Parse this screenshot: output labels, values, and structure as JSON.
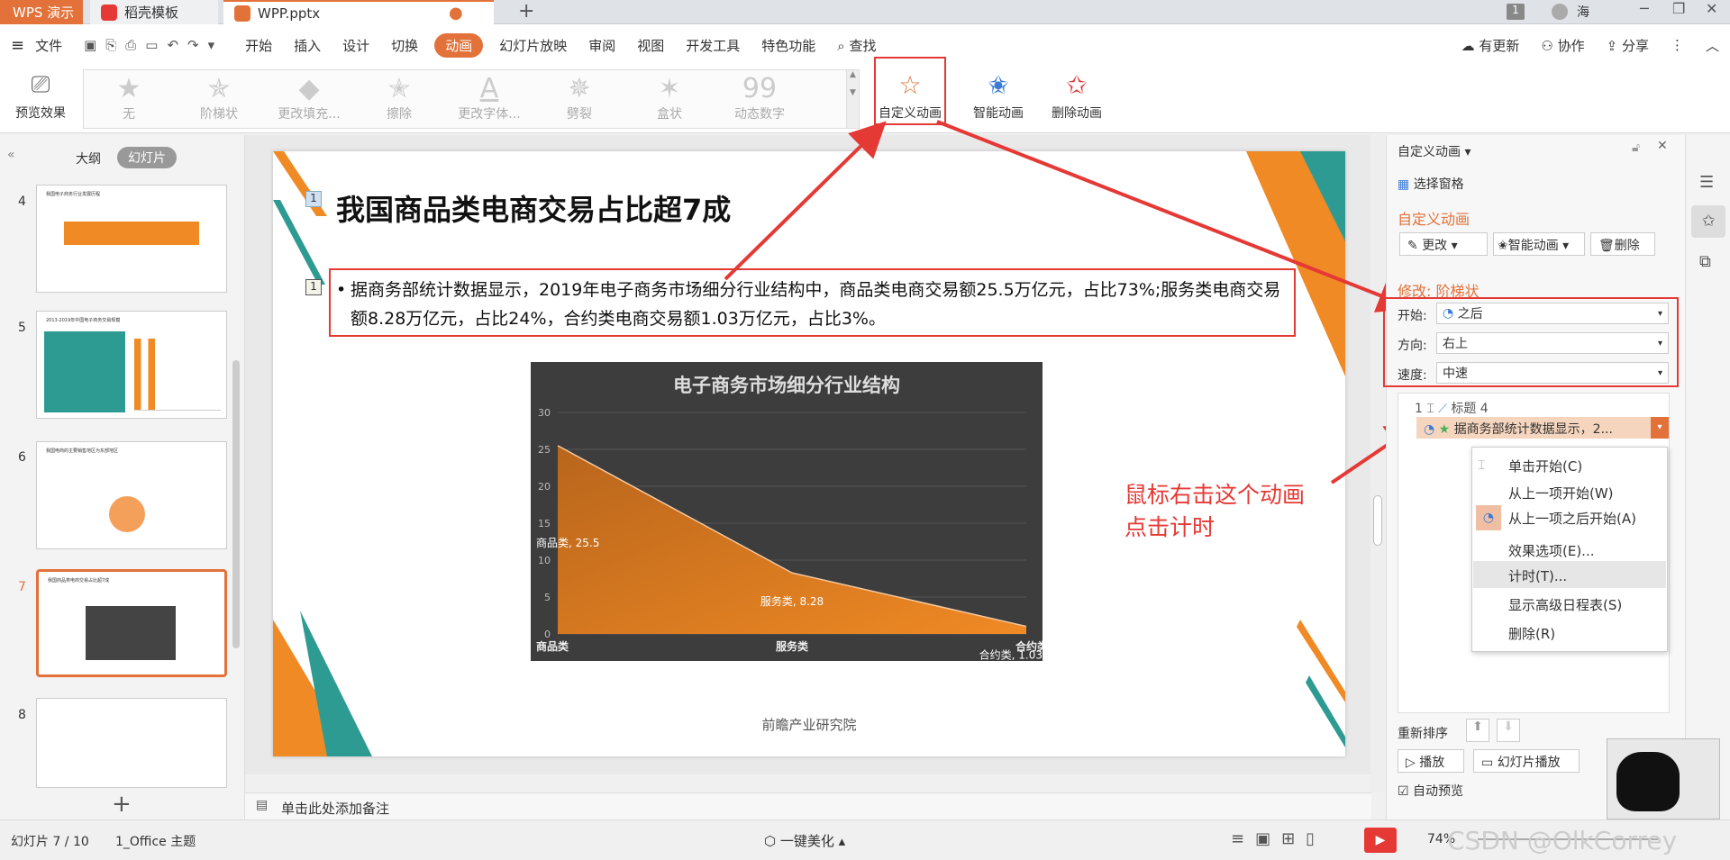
{
  "tabs": {
    "app": "WPS 演示",
    "template": "稻壳模板",
    "file": "WPP.pptx",
    "user": "海",
    "count": "1"
  },
  "menu": {
    "file": "文件",
    "items": [
      "开始",
      "插入",
      "设计",
      "切换",
      "动画",
      "幻灯片放映",
      "审阅",
      "视图",
      "开发工具",
      "特色功能"
    ],
    "active": "动画",
    "search": "查找",
    "right": [
      "有更新",
      "协作",
      "分享"
    ]
  },
  "ribbon": {
    "preview": "预览效果",
    "gallery": [
      "无",
      "阶梯状",
      "更改填充...",
      "擦除",
      "更改字体...",
      "劈裂",
      "盒状",
      "动态数字"
    ],
    "custom": "自定义动画",
    "smart": "智能动画",
    "delete": "删除动画"
  },
  "leftpane": {
    "outline": "大纲",
    "slides": "幻灯片",
    "nums": [
      "4",
      "5",
      "6",
      "7",
      "8"
    ],
    "add": "+",
    "thumb4": "我国电子商务行业发展历程",
    "thumb5": "2013-2019年中国电子商务交易规模",
    "thumb6": "我国电商的主要销售地区为东部地区",
    "thumb7": "我国商品类电商交易占比超7成"
  },
  "slide": {
    "title": "我国商品类电商交易占比超7成",
    "bullet": "据商务部统计数据显示，2019年电子商务市场细分行业结构中，商品类电商交易额25.5万亿元，占比73%;服务类电商交易额8.28万亿元，占比24%，合约类电商交易额1.03万亿元，占比3%。",
    "source": "前瞻产业研究院",
    "marker1": "1",
    "marker2": "1"
  },
  "chart_data": {
    "type": "area",
    "title": "电子商务市场细分行业结构",
    "categories": [
      "商品类",
      "服务类",
      "合约类"
    ],
    "values": [
      25.5,
      8.28,
      1.03
    ],
    "ylim": [
      0,
      30
    ],
    "yticks": [
      0,
      5,
      10,
      15,
      20,
      25,
      30
    ],
    "data_labels": [
      "商品类, 25.5",
      "服务类, 8.28",
      "合约类, 1.03"
    ],
    "color": "#e2771e"
  },
  "annotation": {
    "text1": "鼠标右击这个动画",
    "text2": "点击计时"
  },
  "rightpane": {
    "header": "自定义动画",
    "select": "选择窗格",
    "section": "自定义动画",
    "change": "更改",
    "smart": "智能动画",
    "delete": "删除",
    "modify": "修改: 阶梯状",
    "start_label": "开始:",
    "start_val": "之后",
    "dir_label": "方向:",
    "dir_val": "右上",
    "speed_label": "速度:",
    "speed_val": "中速",
    "item1_num": "1",
    "item1": "标题 4",
    "item2": "据商务部统计数据显示，2...",
    "reorder": "重新排序",
    "play": "播放",
    "slideshow": "幻灯片播放",
    "autopreview": "自动预览"
  },
  "context_menu": [
    "单击开始(C)",
    "从上一项开始(W)",
    "从上一项之后开始(A)",
    "效果选项(E)...",
    "计时(T)...",
    "显示高级日程表(S)",
    "删除(R)"
  ],
  "status": {
    "slide": "幻灯片 7 / 10",
    "theme": "1_Office 主题",
    "beautify": "一键美化",
    "zoom": "74%",
    "watermark": "CSDN @OlkCorrey"
  },
  "notes": "单击此处添加备注"
}
